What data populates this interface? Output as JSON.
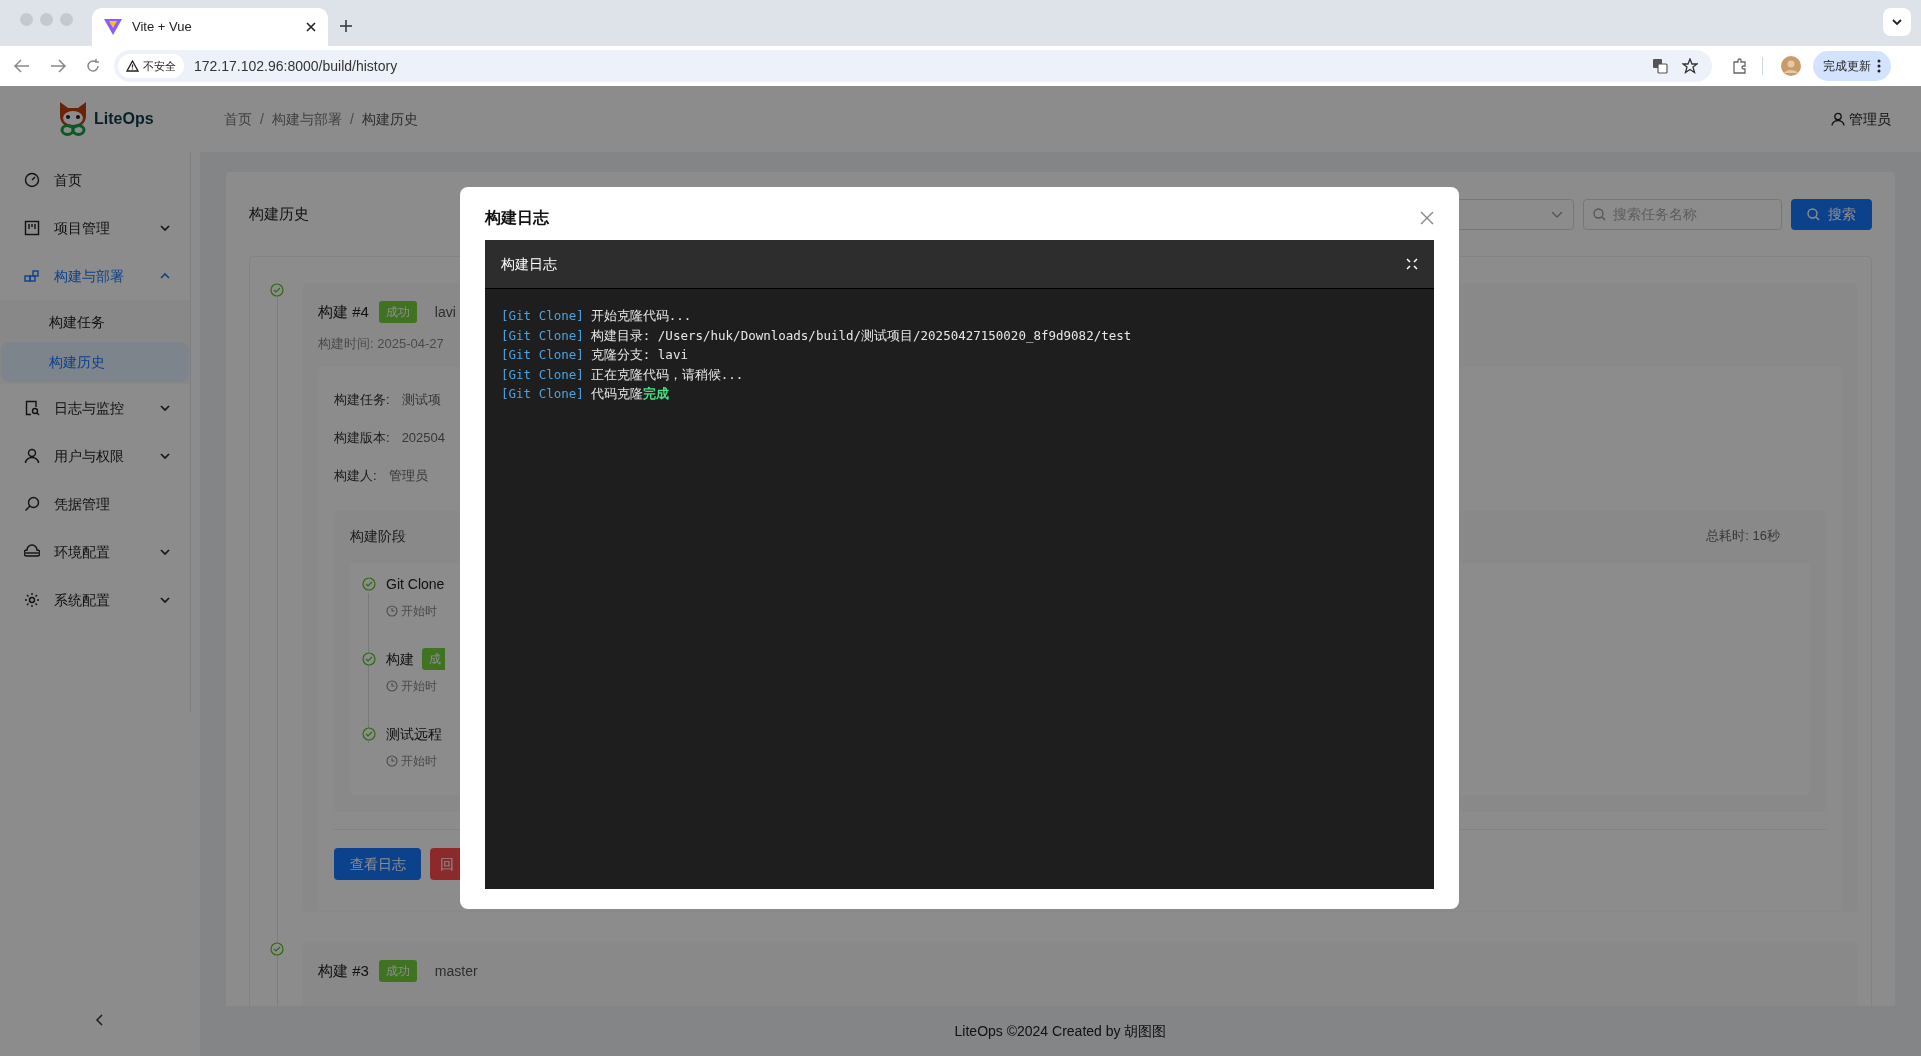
{
  "browser": {
    "tab_title": "Vite + Vue",
    "security_label": "不安全",
    "url": "172.17.102.96:8000/build/history",
    "update_button": "完成更新"
  },
  "sidebar": {
    "logo_text": "LiteOps",
    "items": [
      {
        "label": "首页",
        "selected": false
      },
      {
        "label": "项目管理",
        "selected": false,
        "expanded": false
      },
      {
        "label": "构建与部署",
        "selected": true,
        "expanded": true,
        "children": [
          {
            "label": "构建任务",
            "selected": false
          },
          {
            "label": "构建历史",
            "selected": true
          }
        ]
      },
      {
        "label": "日志与监控",
        "selected": false,
        "expanded": false
      },
      {
        "label": "用户与权限",
        "selected": false,
        "expanded": false
      },
      {
        "label": "凭据管理",
        "selected": false
      },
      {
        "label": "环境配置",
        "selected": false,
        "expanded": false
      },
      {
        "label": "系统配置",
        "selected": false,
        "expanded": false
      }
    ]
  },
  "header": {
    "breadcrumb": [
      "首页",
      "构建与部署",
      "构建历史"
    ],
    "separator": "/",
    "user": "管理员"
  },
  "page": {
    "title": "构建历史",
    "search": {
      "placeholder": "搜索任务名称"
    },
    "search_button": "搜索"
  },
  "builds": [
    {
      "title": "构建 #4",
      "status": "成功",
      "branch": "lavi",
      "time": "构建时间: 2025-04-27",
      "details": [
        {
          "label": "构建任务:",
          "value": "测试项"
        },
        {
          "label": "构建版本:",
          "value": "202504"
        },
        {
          "label": "构建人:",
          "value": "管理员"
        }
      ],
      "stages_title": "构建阶段",
      "total": "总耗时: 16秒",
      "stages": [
        {
          "name": "Git Clone",
          "start": "开始时"
        },
        {
          "name": "构建",
          "badge": "成",
          "start": "开始时"
        },
        {
          "name": "测试远程",
          "start": "开始时"
        }
      ],
      "actions": [
        {
          "label": "查看日志",
          "kind": "primary"
        },
        {
          "label": "回",
          "kind": "danger"
        }
      ]
    },
    {
      "title": "构建 #3",
      "status": "成功",
      "branch": "master"
    }
  ],
  "modal": {
    "title": "构建日志",
    "log": {
      "title": "构建日志",
      "lines": [
        {
          "tag": "[Git Clone]",
          "parts": [
            {
              "text": "开始克隆代码...",
              "kind": "plain"
            }
          ]
        },
        {
          "tag": "[Git Clone]",
          "parts": [
            {
              "text": "构建目录: /Users/huk/Downloads/build/测试项目/20250427150020_8f9d9082/test",
              "kind": "plain"
            }
          ]
        },
        {
          "tag": "[Git Clone]",
          "parts": [
            {
              "text": "克隆分支: lavi",
              "kind": "plain"
            }
          ]
        },
        {
          "tag": "[Git Clone]",
          "parts": [
            {
              "text": "正在克隆代码，请稍候...",
              "kind": "plain"
            }
          ]
        },
        {
          "tag": "[Git Clone]",
          "parts": [
            {
              "text": "代码克隆",
              "kind": "plain"
            },
            {
              "text": "完成",
              "kind": "success"
            }
          ]
        }
      ]
    }
  },
  "footer": "LiteOps ©2024 Created by 胡图图"
}
